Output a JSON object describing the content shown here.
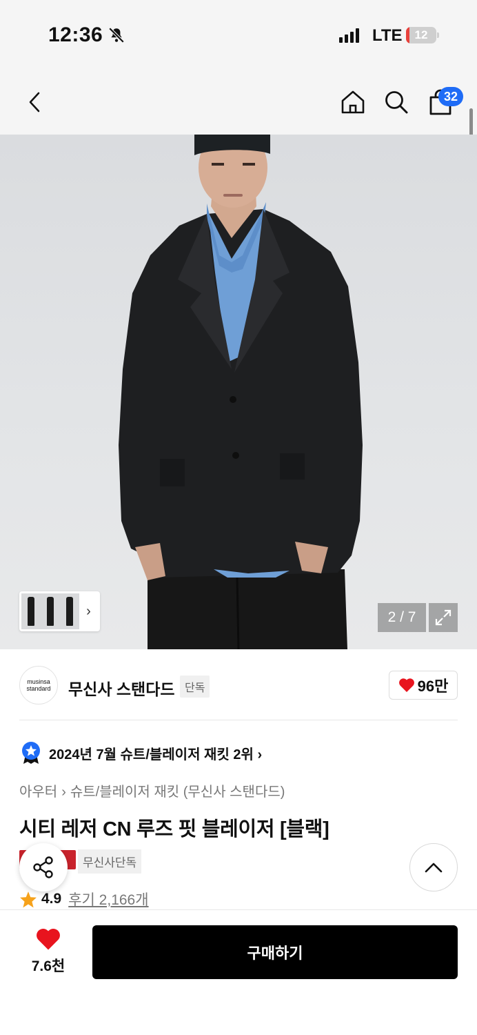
{
  "status_bar": {
    "time": "12:36",
    "network": "LTE",
    "battery": "12",
    "battery_level": 0.12
  },
  "header": {
    "cart_count": "32"
  },
  "gallery": {
    "pager": "2 / 7"
  },
  "brand": {
    "logo_line1": "musinsa",
    "logo_line2": "standard",
    "name": "무신사 스탠다드",
    "tag": "단독",
    "likes": "96만"
  },
  "ranking": {
    "text": "2024년 7월 슈트/블레이저 재킷 2위"
  },
  "breadcrumb": {
    "level1": "아우터",
    "level2": "슈트/블레이저 재킷 (무신사 스탠다드)"
  },
  "product": {
    "title": "시티 레저 CN 루즈 핏 블레이저 [블랙]",
    "tag": "무신사단독"
  },
  "rating": {
    "score": "4.9",
    "reviews": "후기 2,166개"
  },
  "bottom_bar": {
    "like_count": "7.6천",
    "buy_label": "구매하기"
  },
  "colors": {
    "accent_blue": "#1f6cf6",
    "heart_red": "#e8141e",
    "buy_black": "#000000"
  }
}
